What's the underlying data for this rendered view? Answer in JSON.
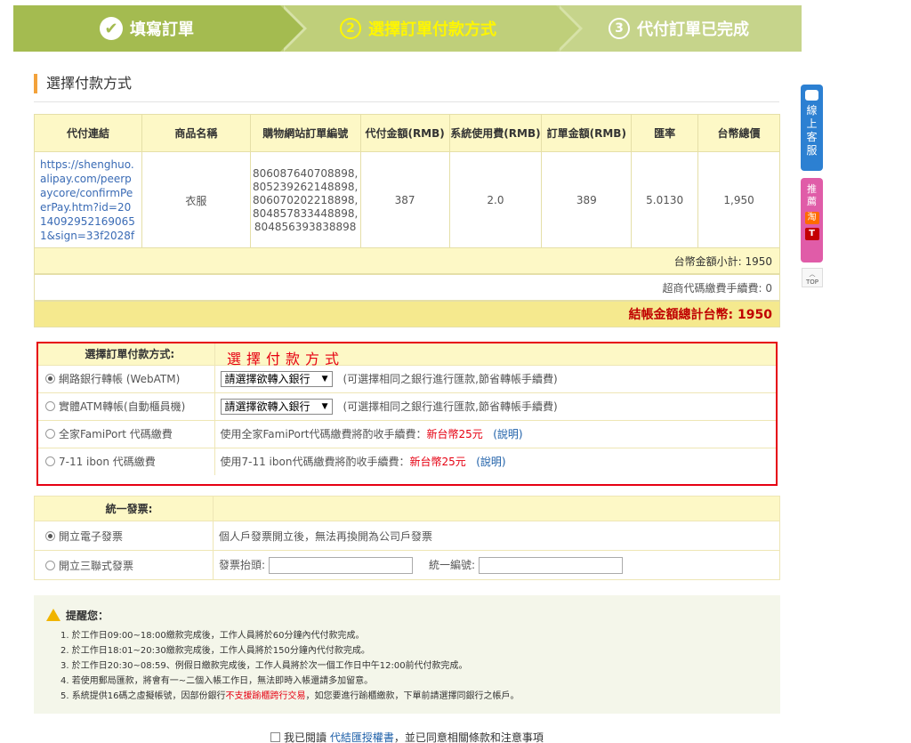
{
  "steps": [
    {
      "label": "填寫訂單",
      "num": "✔"
    },
    {
      "label": "選擇訂單付款方式",
      "num": "2"
    },
    {
      "label": "代付訂單已完成",
      "num": "3"
    }
  ],
  "section_title": "選擇付款方式",
  "order_table": {
    "headers": [
      "代付連結",
      "商品名稱",
      "購物網站訂單編號",
      "代付金額(RMB)",
      "系統使用費(RMB)",
      "訂單金額(RMB)",
      "匯率",
      "台幣總價"
    ],
    "row": {
      "link": "https://shenghuo.alipay.com/peerpaycore/confirmPeerPay.htm?id=20140929521690651&sign=33f2028f",
      "product": "衣服",
      "order_ids": [
        "806087640708898,",
        "805239262148898,",
        "806070202218898,",
        "804857833448898,",
        "804856393838898"
      ],
      "pay_amount": "387",
      "system_fee": "2.0",
      "order_amount": "389",
      "rate": "5.0130",
      "twd_total": "1,950"
    }
  },
  "summary": {
    "subtotal": "台幣金額小計: 1950",
    "store_fee": "超商代碼繳費手續費: 0",
    "grand_total": "結帳金額總計台幣: 1950"
  },
  "payment": {
    "header": "選擇訂單付款方式:",
    "annotation": "選擇付款方式",
    "options": [
      {
        "label": "網路銀行轉帳 (WebATM)",
        "select": "請選擇欲轉入銀行",
        "note": "(可選擇相同之銀行進行匯款,節省轉帳手續費)",
        "checked": true
      },
      {
        "label": "實體ATM轉帳(自動櫃員機)",
        "select": "請選擇欲轉入銀行",
        "note": "(可選擇相同之銀行進行匯款,節省轉帳手續費)",
        "checked": false
      },
      {
        "label": "全家FamiPort 代碼繳費",
        "desc": "使用全家FamiPort代碼繳費將酌收手續費：",
        "fee": "新台幣25元",
        "link": "(說明)",
        "checked": false
      },
      {
        "label": "7-11 ibon 代碼繳費",
        "desc": "使用7-11 ibon代碼繳費將酌收手續費：",
        "fee": "新台幣25元",
        "link": "(說明)",
        "checked": false
      }
    ]
  },
  "invoice": {
    "header": "統一發票:",
    "options": [
      {
        "label": "開立電子發票",
        "desc": "個人戶發票開立後，無法再換開為公司戶發票",
        "checked": true
      },
      {
        "label": "開立三聯式發票",
        "title_label": "發票抬頭:",
        "tax_label": "統一編號:",
        "checked": false
      }
    ]
  },
  "notice": {
    "title": "提醒您：",
    "items": [
      "1. 於工作日09:00~18:00繳款完成後，工作人員將於60分鐘內代付款完成。",
      "2. 於工作日18:01~20:30繳款完成後，工作人員將於150分鐘內代付款完成。",
      "3. 於工作日20:30~08:59、例假日繳款完成後，工作人員將於次一個工作日中午12:00前代付款完成。",
      "4. 若使用郵局匯款，將會有一~二個入帳工作日，無法即時入帳還請多加留意。"
    ],
    "item5_pre": "5. 系統提供16碼之虛擬帳號，因部份銀行",
    "item5_red": "不支援踰櫃跨行交易",
    "item5_post": "，如您要進行踰櫃繳款，下單前請選擇同銀行之帳戶。"
  },
  "agree": {
    "pre": "我已閱讀",
    "link": "代結匯授權書",
    "post": "，並已同意相關條款和注意事項"
  },
  "float": {
    "service": "線上客服",
    "recommend": "推薦",
    "tao": "淘",
    "tmall": "T",
    "top": "TOP"
  },
  "colors": {
    "step_green": "#a4bb50",
    "highlight_yellow": "#fff600",
    "alert_red": "#e60012",
    "total_red": "#c00000"
  }
}
